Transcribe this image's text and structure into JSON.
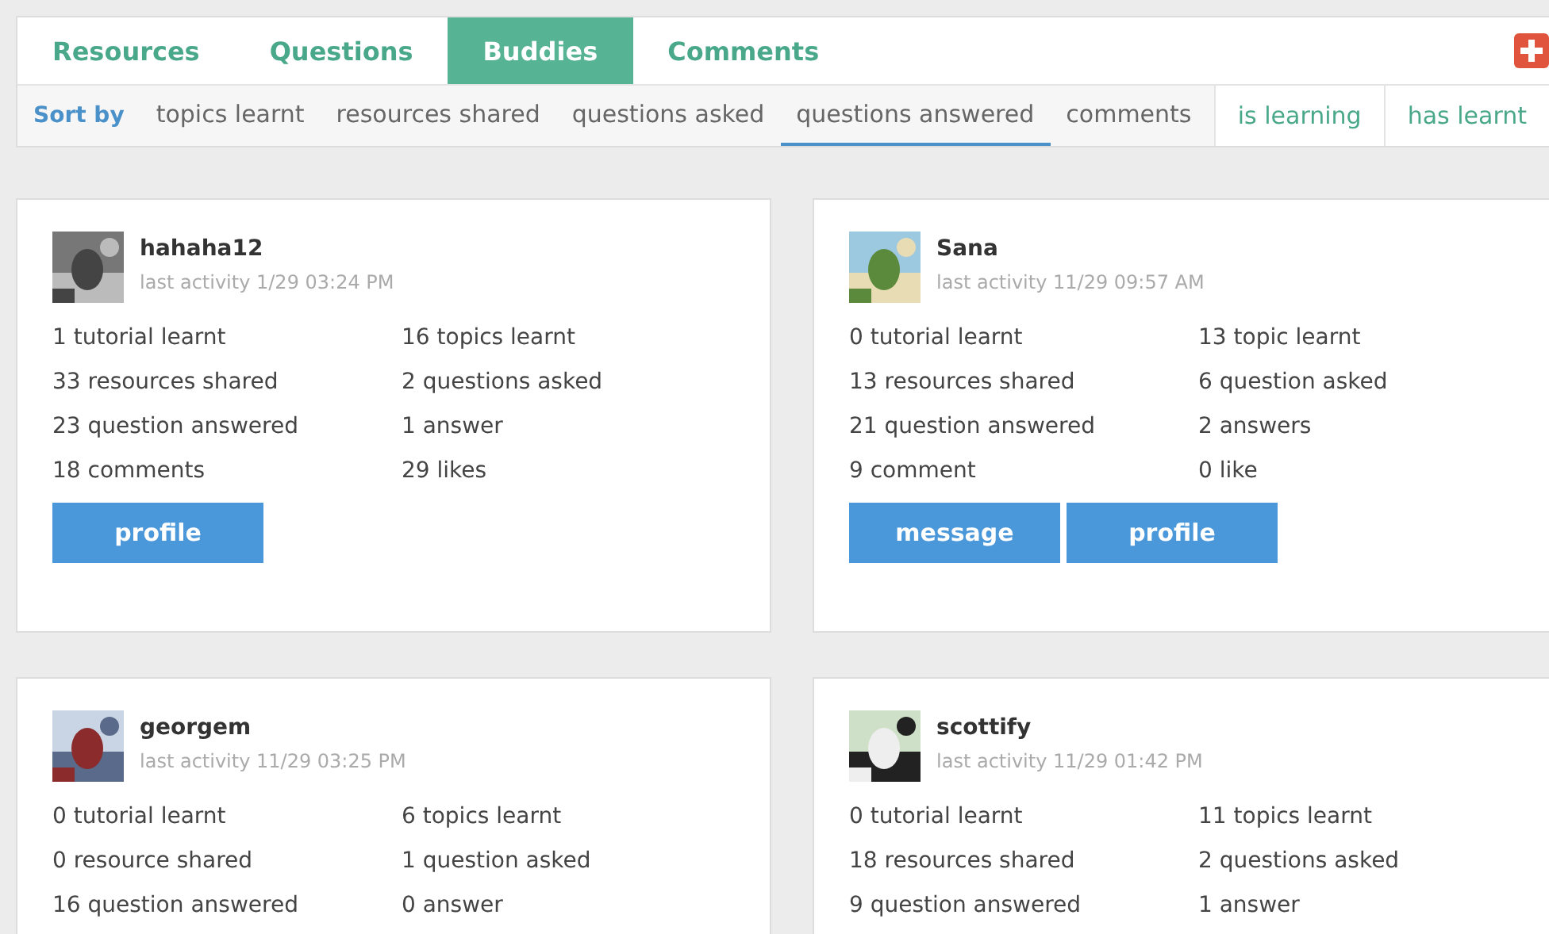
{
  "tabs": [
    {
      "label": "Resources",
      "selected": false
    },
    {
      "label": "Questions",
      "selected": false
    },
    {
      "label": "Buddies",
      "selected": true
    },
    {
      "label": "Comments",
      "selected": false
    }
  ],
  "sort": {
    "label": "Sort by",
    "options": [
      {
        "label": "topics learnt",
        "selected": false
      },
      {
        "label": "resources shared",
        "selected": false
      },
      {
        "label": "questions asked",
        "selected": false
      },
      {
        "label": "questions answered",
        "selected": true
      },
      {
        "label": "comments",
        "selected": false
      }
    ]
  },
  "filters": [
    "is learning",
    "has learnt"
  ],
  "buddies": [
    {
      "name": "hahaha12",
      "activity": "last activity 1/29 03:24 PM",
      "stats": [
        "1 tutorial learnt",
        "16 topics learnt",
        "33 resources shared",
        "2 questions asked",
        "23 question answered",
        "1 answer",
        "18 comments",
        "29 likes"
      ],
      "buttons": [
        "profile"
      ]
    },
    {
      "name": "Sana",
      "activity": "last activity 11/29 09:57 AM",
      "stats": [
        "0 tutorial learnt",
        "13 topic learnt",
        "13 resources shared",
        "6 question asked",
        "21 question answered",
        "2 answers",
        "9 comment",
        "0 like"
      ],
      "buttons": [
        "message",
        "profile"
      ]
    },
    {
      "name": "georgem",
      "activity": "last activity 11/29 03:25 PM",
      "stats": [
        "0 tutorial learnt",
        "6 topics learnt",
        "0 resource shared",
        "1 question asked",
        "16 question answered",
        "0 answer"
      ]
    },
    {
      "name": "scottify",
      "activity": "last activity 11/29 01:42 PM",
      "stats": [
        "0 tutorial learnt",
        "11 topics learnt",
        "18 resources shared",
        "2 questions asked",
        "9 question answered",
        "1 answer"
      ]
    }
  ]
}
